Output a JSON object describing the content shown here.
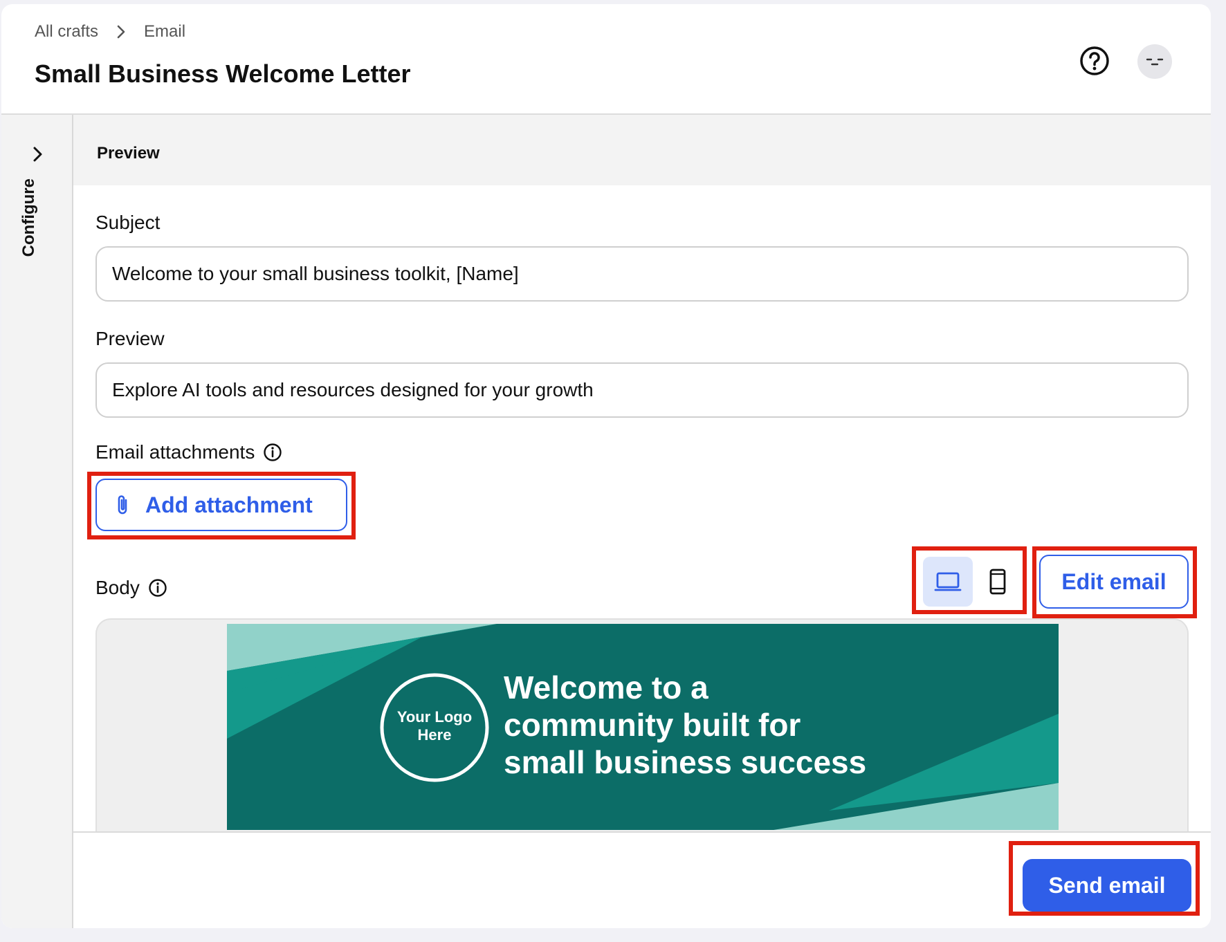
{
  "breadcrumb": {
    "root": "All crafts",
    "current": "Email"
  },
  "page_title": "Small Business Welcome Letter",
  "rail": {
    "label": "Configure"
  },
  "preview_band": {
    "title": "Preview"
  },
  "subject": {
    "label": "Subject",
    "value": "Welcome to your small business toolkit, [Name]"
  },
  "preview_field": {
    "label": "Preview",
    "value": "Explore AI tools and resources designed for your growth"
  },
  "attachments": {
    "label": "Email attachments",
    "button": "Add attachment"
  },
  "body": {
    "label": "Body",
    "edit_button": "Edit email"
  },
  "banner": {
    "logo_text_line1": "Your Logo",
    "logo_text_line2": "Here",
    "headline_line1": "Welcome to a",
    "headline_line2": "community built for",
    "headline_line3": "small business success"
  },
  "footer": {
    "send_button": "Send email"
  },
  "icons": {
    "help": "help-circle-icon",
    "avatar": "avatar-icon",
    "chevron": "chevron-right-icon",
    "info": "info-icon",
    "attachment": "paperclip-icon",
    "desktop": "laptop-icon",
    "mobile": "phone-icon"
  },
  "colors": {
    "accent": "#2f5ee8",
    "banner_dark": "#0c6d67",
    "banner_mid": "#14998b",
    "banner_light": "#91d2c9",
    "highlight": "#e02010"
  }
}
